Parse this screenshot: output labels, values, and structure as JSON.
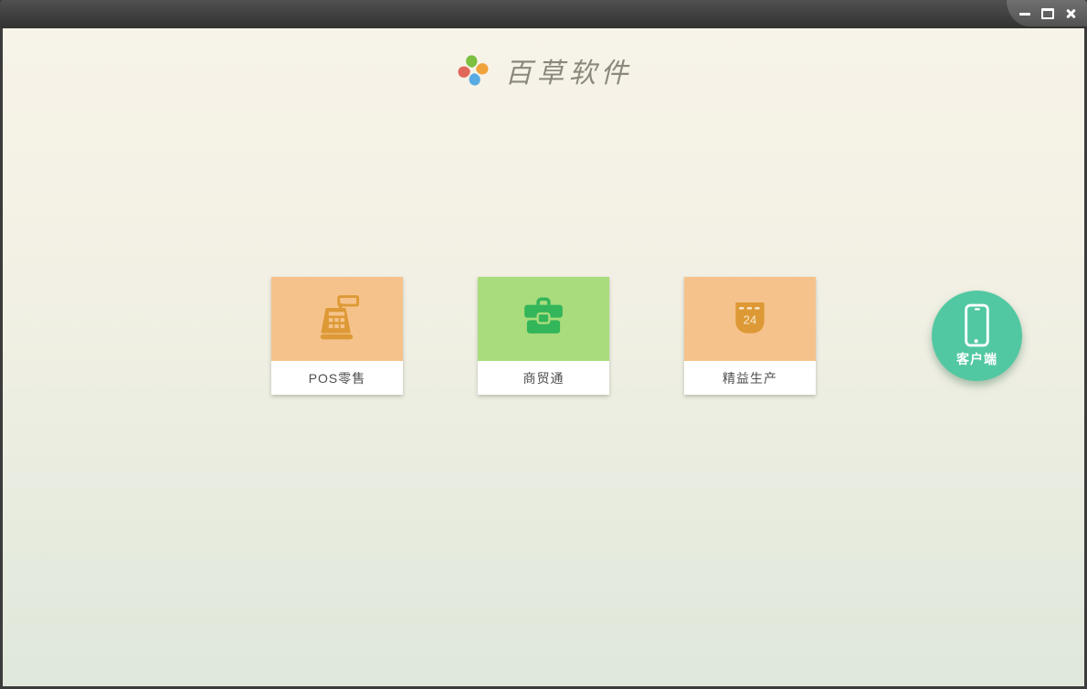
{
  "window": {
    "controls": {
      "minimize_icon": "minimize-icon",
      "maximize_icon": "maximize-icon",
      "close_icon": "close-icon"
    },
    "title_bar_color": "#3d3d3d",
    "controls_tab_color": "#616161"
  },
  "header": {
    "logo_icon": "pinwheel-icon",
    "app_title": "百草软件",
    "logo_petal_colors": {
      "top": "#7cbf41",
      "right": "#f0a23c",
      "bottom": "#58abe2",
      "left": "#e0685a"
    },
    "title_color": "#8a887c"
  },
  "products": [
    {
      "label": "POS零售",
      "icon": "cash-register-icon",
      "tile_bg": "#f6c28b",
      "icon_color": "#dc9935"
    },
    {
      "label": "商贸通",
      "icon": "briefcase-icon",
      "tile_bg": "#a9dc7d",
      "icon_color": "#33b55a"
    },
    {
      "label": "精益生产",
      "icon": "calendar-icon",
      "calendar_day_text": "24",
      "tile_bg": "#f6c28b",
      "icon_color": "#dc9935"
    }
  ],
  "client": {
    "label": "客户端",
    "icon": "smartphone-icon",
    "bg": "#52c8a2"
  },
  "background": {
    "top": "#f7f3e8",
    "bottom": "#dfe8db"
  }
}
